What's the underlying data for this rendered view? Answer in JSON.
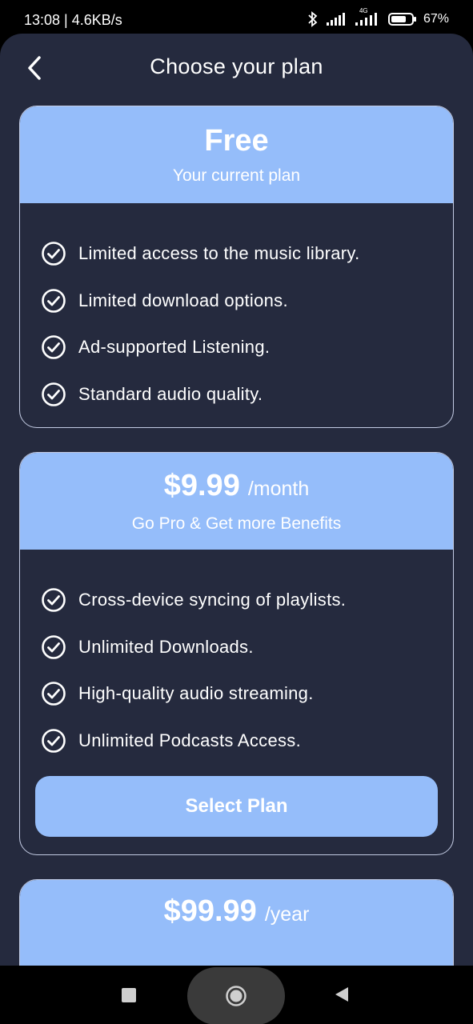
{
  "status": {
    "time": "13:08 | 4.6KB/s",
    "network": "4G",
    "battery": "67%"
  },
  "header": {
    "title": "Choose your plan"
  },
  "plans": [
    {
      "name": "Free",
      "subtitle": "Your current plan",
      "features": [
        "Limited access to the music library.",
        "Limited download options.",
        "Ad-supported Listening.",
        "Standard audio quality."
      ]
    },
    {
      "price": "$9.99",
      "period": "/month",
      "subtitle": "Go Pro & Get more Benefits",
      "features": [
        "Cross-device syncing of playlists.",
        "Unlimited Downloads.",
        "High-quality audio streaming.",
        "Unlimited Podcasts Access."
      ],
      "button_label": "Select Plan"
    },
    {
      "price": "$99.99",
      "period": "/year"
    }
  ],
  "colors": {
    "accent": "#95bdfa",
    "background": "#252a3e",
    "text": "#ffffff"
  },
  "icons": {
    "back": "chevron-left-icon",
    "feature": "check-circle-icon",
    "nav_recents": "square-icon",
    "nav_home": "circle-icon",
    "nav_back": "triangle-left-icon"
  }
}
